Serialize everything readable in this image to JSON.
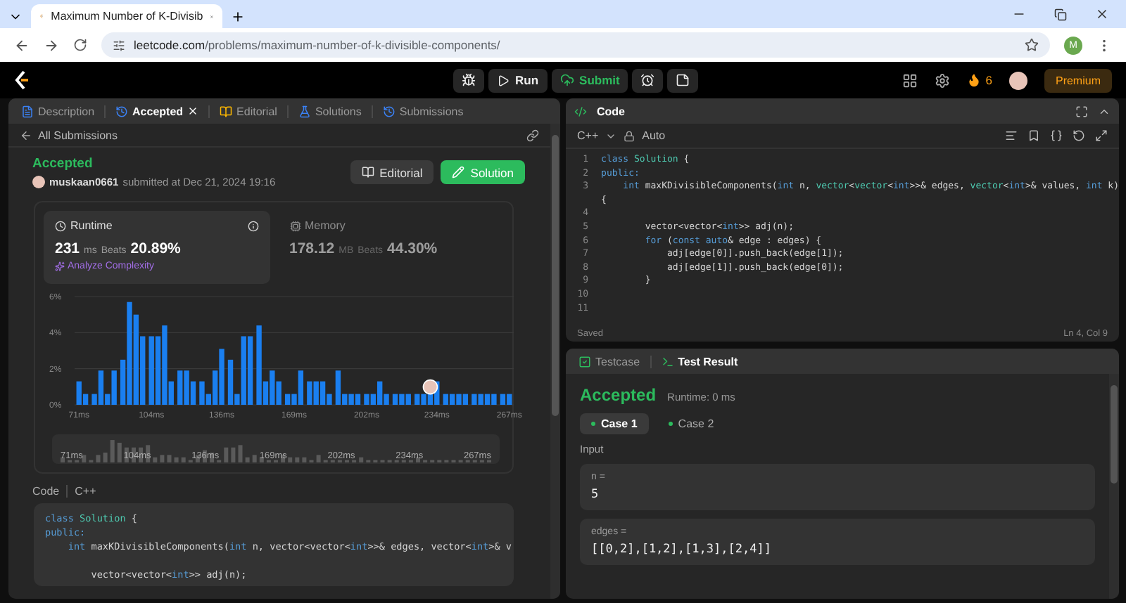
{
  "browser": {
    "tab_title": "Maximum Number of K-Divisib",
    "url_host": "leetcode.com",
    "url_path": "/problems/maximum-number-of-k-divisible-components/",
    "profile_initial": "M"
  },
  "nav": {
    "run": "Run",
    "submit": "Submit",
    "streak": "6",
    "premium": "Premium"
  },
  "left_panel": {
    "tabs": [
      {
        "label": "Description",
        "selected": false,
        "closable": false
      },
      {
        "label": "Accepted",
        "selected": true,
        "closable": true
      },
      {
        "label": "Editorial",
        "selected": false,
        "closable": false
      },
      {
        "label": "Solutions",
        "selected": false,
        "closable": false
      },
      {
        "label": "Submissions",
        "selected": false,
        "closable": false
      }
    ],
    "back_link": "All Submissions",
    "submission": {
      "status": "Accepted",
      "user": "muskaan0661",
      "submitted": "submitted at Dec 21, 2024 19:16"
    },
    "actions": [
      {
        "label": "Editorial",
        "kind": "secondary"
      },
      {
        "label": "Solution",
        "kind": "primary"
      }
    ],
    "stats": [
      {
        "title": "Runtime",
        "selected": true,
        "value": "231",
        "unit": "ms",
        "beats_label": "Beats",
        "beats": "20.89%",
        "extra": "Analyze Complexity"
      },
      {
        "title": "Memory",
        "selected": false,
        "value": "178.12",
        "unit": "MB",
        "beats_label": "Beats",
        "beats": "44.30%"
      }
    ],
    "chart_data": {
      "type": "bar",
      "ylim": [
        0,
        6
      ],
      "xlim": [
        69,
        269
      ],
      "yticks": [
        {
          "value": 0,
          "label": "0%"
        },
        {
          "value": 2,
          "label": "2%"
        },
        {
          "value": 4,
          "label": "4%"
        },
        {
          "value": 6,
          "label": "6%"
        }
      ],
      "x": [
        71,
        74,
        78,
        81,
        84,
        87,
        91,
        94,
        97,
        100,
        104,
        107,
        110,
        113,
        117,
        120,
        123,
        127,
        130,
        133,
        136,
        140,
        143,
        146,
        149,
        153,
        156,
        159,
        162,
        166,
        169,
        172,
        176,
        179,
        182,
        185,
        189,
        192,
        195,
        198,
        202,
        205,
        208,
        211,
        215,
        218,
        221,
        225,
        228,
        231,
        234,
        238,
        241,
        244,
        247,
        251,
        254,
        257,
        260,
        264,
        267
      ],
      "xticks": [
        {
          "value": 71,
          "label": "71ms"
        },
        {
          "value": 104,
          "label": "104ms"
        },
        {
          "value": 136,
          "label": "136ms"
        },
        {
          "value": 169,
          "label": "169ms"
        },
        {
          "value": 202,
          "label": "202ms"
        },
        {
          "value": 234,
          "label": "234ms"
        },
        {
          "value": 267,
          "label": "267ms"
        }
      ],
      "series": [
        {
          "color": "#1a7ff0",
          "values": [
            1.3,
            0.6,
            0.6,
            1.9,
            0.6,
            1.9,
            2.5,
            5.7,
            5.0,
            3.8,
            3.8,
            3.8,
            4.4,
            1.3,
            1.9,
            1.9,
            1.3,
            1.3,
            0.6,
            1.9,
            3.1,
            2.5,
            0.6,
            3.8,
            3.8,
            4.4,
            1.3,
            1.9,
            1.3,
            0.6,
            0.6,
            1.9,
            1.3,
            1.3,
            1.3,
            0.6,
            1.9,
            0.6,
            0.6,
            0.6,
            0.6,
            0.6,
            1.3,
            0.6,
            0.6,
            0.6,
            0.6,
            0.6,
            0.6,
            0.6,
            1.3,
            0.6,
            0.6,
            0.6,
            0.6,
            0.6,
            0.6,
            0.6,
            0.6,
            0.6,
            0.6
          ]
        }
      ]
    },
    "range_labels": [
      "71ms",
      "104ms",
      "136ms",
      "169ms",
      "202ms",
      "234ms",
      "267ms"
    ],
    "code_header": {
      "label": "Code",
      "language": "C++"
    },
    "code_lines": [
      {
        "kind": "code",
        "tokens": [
          {
            "text": "class",
            "kind": "k"
          },
          {
            "text": " Solution",
            "kind": "t"
          },
          {
            "text": " {",
            "kind": "p"
          }
        ]
      },
      {
        "kind": "code",
        "tokens": [
          {
            "text": "public:",
            "kind": "k"
          }
        ]
      },
      {
        "kind": "code",
        "tokens": [
          {
            "text": "    int",
            "kind": "k"
          },
          {
            "text": " maxKDivisibleComponents(",
            "kind": "p"
          },
          {
            "text": "int",
            "kind": "k"
          },
          {
            "text": " n, vector<vector<",
            "kind": "p"
          },
          {
            "text": "int",
            "kind": "k"
          },
          {
            "text": ">>& edges, vector<",
            "kind": "p"
          },
          {
            "text": "int",
            "kind": "k"
          },
          {
            "text": ">& v",
            "kind": "p"
          }
        ]
      },
      {
        "kind": "blank"
      },
      {
        "kind": "code",
        "tokens": [
          {
            "text": "        vector<vector<",
            "kind": "p"
          },
          {
            "text": "int",
            "kind": "k"
          },
          {
            "text": ">> adj(n);",
            "kind": "p"
          }
        ]
      }
    ]
  },
  "editor": {
    "title": "Code",
    "language": "C++",
    "mode": "Auto",
    "status": "Saved",
    "cursor": "Ln 4, Col 9",
    "lines": [
      {
        "num": "1",
        "kind": "code",
        "tokens": [
          {
            "text": "class",
            "kind": "k"
          },
          {
            "text": " Solution",
            "kind": "t"
          },
          {
            "text": " {",
            "kind": "p"
          }
        ]
      },
      {
        "num": "2",
        "kind": "code",
        "tokens": [
          {
            "text": "public:",
            "kind": "k"
          }
        ]
      },
      {
        "num": "3",
        "kind": "code",
        "tokens": [
          {
            "text": "    int",
            "kind": "k"
          },
          {
            "text": " maxKDivisibleComponents(",
            "kind": "p"
          },
          {
            "text": "int",
            "kind": "k"
          },
          {
            "text": " n, ",
            "kind": "p"
          },
          {
            "text": "vector",
            "kind": "t"
          },
          {
            "text": "<",
            "kind": "p"
          },
          {
            "text": "vector",
            "kind": "t"
          },
          {
            "text": "<",
            "kind": "p"
          },
          {
            "text": "int",
            "kind": "k"
          },
          {
            "text": ">>& edges, ",
            "kind": "p"
          },
          {
            "text": "vector",
            "kind": "t"
          },
          {
            "text": "<",
            "kind": "p"
          },
          {
            "text": "int",
            "kind": "k"
          },
          {
            "text": ">& values, ",
            "kind": "p"
          },
          {
            "text": "int",
            "kind": "k"
          },
          {
            "text": " k)",
            "kind": "p"
          }
        ]
      },
      {
        "kind": "code",
        "tokens": [
          {
            "text": "{",
            "kind": "p"
          }
        ]
      },
      {
        "num": "4",
        "kind": "blank"
      },
      {
        "num": "5",
        "kind": "code",
        "tokens": [
          {
            "text": "        vector<vector<",
            "kind": "p"
          },
          {
            "text": "int",
            "kind": "k"
          },
          {
            "text": ">> adj(n);",
            "kind": "p"
          }
        ]
      },
      {
        "num": "6",
        "kind": "code",
        "tokens": [
          {
            "text": "        for",
            "kind": "k"
          },
          {
            "text": " (",
            "kind": "p"
          },
          {
            "text": "const",
            "kind": "k"
          },
          {
            "text": " auto",
            "kind": "k"
          },
          {
            "text": "& edge : edges) {",
            "kind": "p"
          }
        ]
      },
      {
        "num": "7",
        "kind": "code",
        "tokens": [
          {
            "text": "            adj[edge[0]].push_back(edge[1]);",
            "kind": "p"
          }
        ]
      },
      {
        "num": "8",
        "kind": "code",
        "tokens": [
          {
            "text": "            adj[edge[1]].push_back(edge[0]);",
            "kind": "p"
          }
        ]
      },
      {
        "num": "9",
        "kind": "code",
        "tokens": [
          {
            "text": "        }",
            "kind": "p"
          }
        ]
      },
      {
        "num": "10",
        "kind": "blank"
      },
      {
        "num": "11",
        "kind": "blank"
      }
    ]
  },
  "results": {
    "tabs": [
      {
        "label": "Testcase",
        "selected": false
      },
      {
        "label": "Test Result",
        "selected": true
      }
    ],
    "status": "Accepted",
    "runtime": "Runtime: 0 ms",
    "input_label": "Input",
    "cases": [
      {
        "label": "Case 1",
        "selected": true
      },
      {
        "label": "Case 2",
        "selected": false
      }
    ],
    "inputs": [
      {
        "name": "n =",
        "value": "5"
      },
      {
        "name": "edges =",
        "value": "[[0,2],[1,2],[1,3],[2,4]]"
      }
    ]
  }
}
